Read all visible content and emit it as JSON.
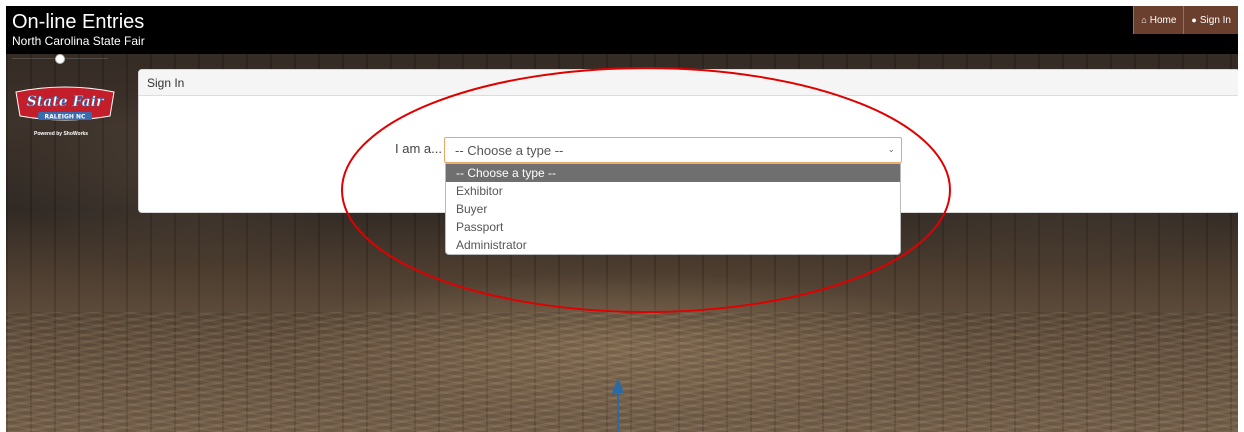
{
  "header": {
    "title": "On-line Entries",
    "subtitle": "North Carolina State Fair",
    "nav": [
      {
        "label": "Home",
        "icon": "home-icon"
      },
      {
        "label": "Sign In",
        "icon": "user-icon"
      }
    ]
  },
  "sidebar": {
    "logo_text": "State Fair",
    "logo_subtext": "RALEIGH NC",
    "powered_by": "Powered by ShoWorks"
  },
  "panel": {
    "title": "Sign In",
    "field_label": "I am a...",
    "select_value": "-- Choose a type --",
    "options": [
      "-- Choose a type --",
      "Exhibitor",
      "Buyer",
      "Passport",
      "Administrator"
    ],
    "selected_index": 0
  },
  "colors": {
    "nav_button": "#6b3f2e",
    "topbar": "#000000",
    "focus_border": "#e8a86a",
    "selected_option": "#6f6f6f",
    "annotation_ellipse": "#e00000",
    "annotation_arrow": "#2a6aa5"
  }
}
